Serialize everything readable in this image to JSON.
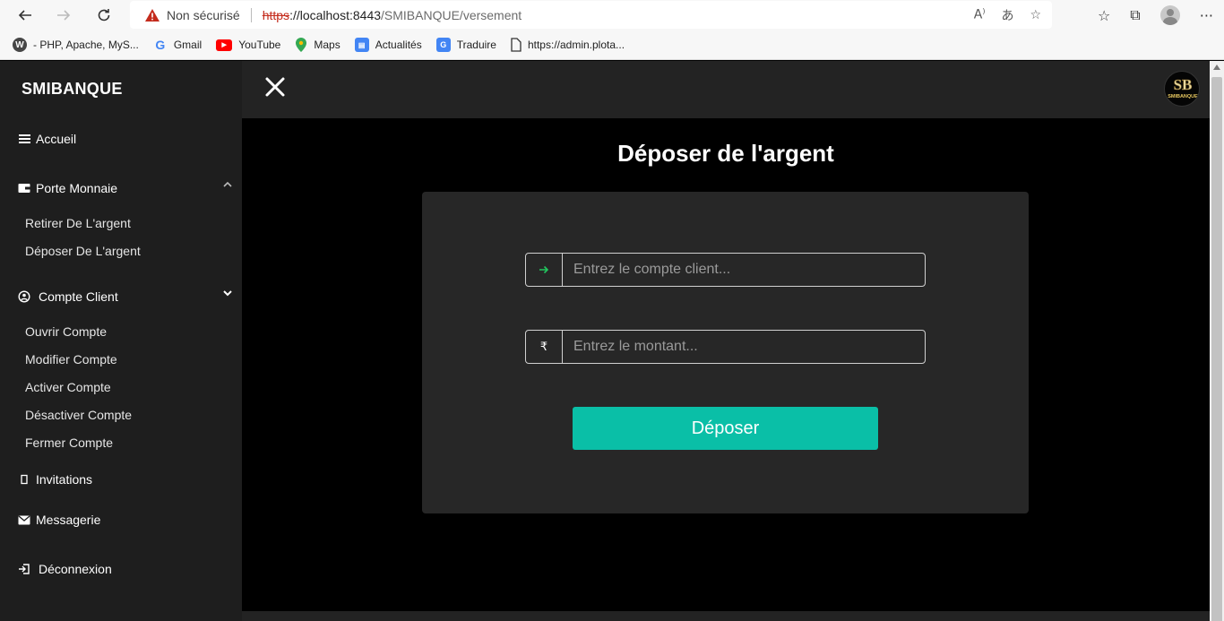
{
  "browser": {
    "insecure_label": "Non sécurisé",
    "url_scheme": "https",
    "url_host": "://localhost:8443",
    "url_path": "/SMIBANQUE/versement"
  },
  "bookmarks": [
    {
      "label": "- PHP, Apache, MyS...",
      "icon": "wordpress-icon"
    },
    {
      "label": "Gmail",
      "icon": "google-icon"
    },
    {
      "label": "YouTube",
      "icon": "youtube-icon"
    },
    {
      "label": "Maps",
      "icon": "maps-pin-icon"
    },
    {
      "label": "Actualités",
      "icon": "news-icon"
    },
    {
      "label": "Traduire",
      "icon": "translate-icon"
    },
    {
      "label": "https://admin.plota...",
      "icon": "page-icon"
    }
  ],
  "sidebar": {
    "brand": "SMIBANQUE",
    "accueil": "Accueil",
    "porte_monnaie": "Porte Monnaie",
    "retirer": "Retirer De L'argent",
    "deposer": "Déposer De L'argent",
    "compte_client": "Compte Client",
    "ouvrir": "Ouvrir Compte",
    "modifier": "Modifier Compte",
    "activer": "Activer Compte",
    "desactiver": "Désactiver Compte",
    "fermer": "Fermer Compte",
    "invitations": "Invitations",
    "messagerie": "Messagerie",
    "deconnexion": "Déconnexion"
  },
  "main": {
    "title": "Déposer de l'argent",
    "account_placeholder": "Entrez le compte client...",
    "amount_placeholder": "Entrez le montant...",
    "amount_symbol": "₹",
    "submit_label": "Déposer"
  },
  "logo": {
    "text": "SB",
    "subtext": "SMIBANQUE"
  },
  "colors": {
    "accent": "#0abfa7",
    "sidebar_bg": "#1e1e1e",
    "card_bg": "#272727",
    "arrow_green": "#22c55e"
  }
}
